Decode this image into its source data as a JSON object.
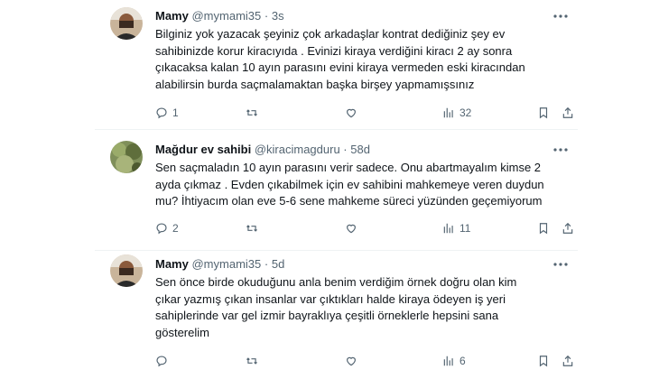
{
  "tweets": [
    {
      "name": "Mamy",
      "handle": "@mymami35",
      "sep": "·",
      "time": "3s",
      "text": "Bilginiz yok yazacak şeyiniz çok arkadaşlar kontrat dediğiniz şey ev\nsahibinizde korur kiracıyıda . Evinizi kiraya verdiğini kiracı 2 ay sonra\nçıkacaksa kalan 10 ayın parasını evini kiraya vermeden eski kiracından\nalabilirsin burda saçmalamaktan başka birşey yapmamışsınız",
      "replies": "1",
      "retweets": "",
      "likes": "",
      "views": "32"
    },
    {
      "name": "Mağdur ev sahibi",
      "handle": "@kiracimagduru",
      "sep": "·",
      "time": "58d",
      "text": "Sen saçmaladın 10 ayın parasını verir sadece. Onu abartmayalım kimse 2\nayda çıkmaz . Evden çıkabilmek için ev sahibini mahkemeye veren duydun\nmu? İhtiyacım olan eve 5-6 sene mahkeme süreci yüzünden geçemiyorum",
      "replies": "2",
      "retweets": "",
      "likes": "",
      "views": "11"
    },
    {
      "name": "Mamy",
      "handle": "@mymami35",
      "sep": "·",
      "time": "5d",
      "text": "Sen önce birde okuduğunu anla  benim verdiğim örnek doğru olan kim\nçıkar yazmış çıkan insanlar var çıktıkları halde kiraya ödeyen iş yeri\nsahiplerinde var gel izmir bayraklıya çeşitli örneklerle hepsini sana\ngösterelim",
      "replies": "",
      "retweets": "",
      "likes": "",
      "views": "6"
    }
  ],
  "colors": {
    "text": "#0f1419",
    "secondary": "#536471",
    "divider": "#eff3f4"
  },
  "icons": [
    "more-icon",
    "reply-icon",
    "retweet-icon",
    "like-icon",
    "views-icon",
    "bookmark-icon",
    "share-icon"
  ]
}
